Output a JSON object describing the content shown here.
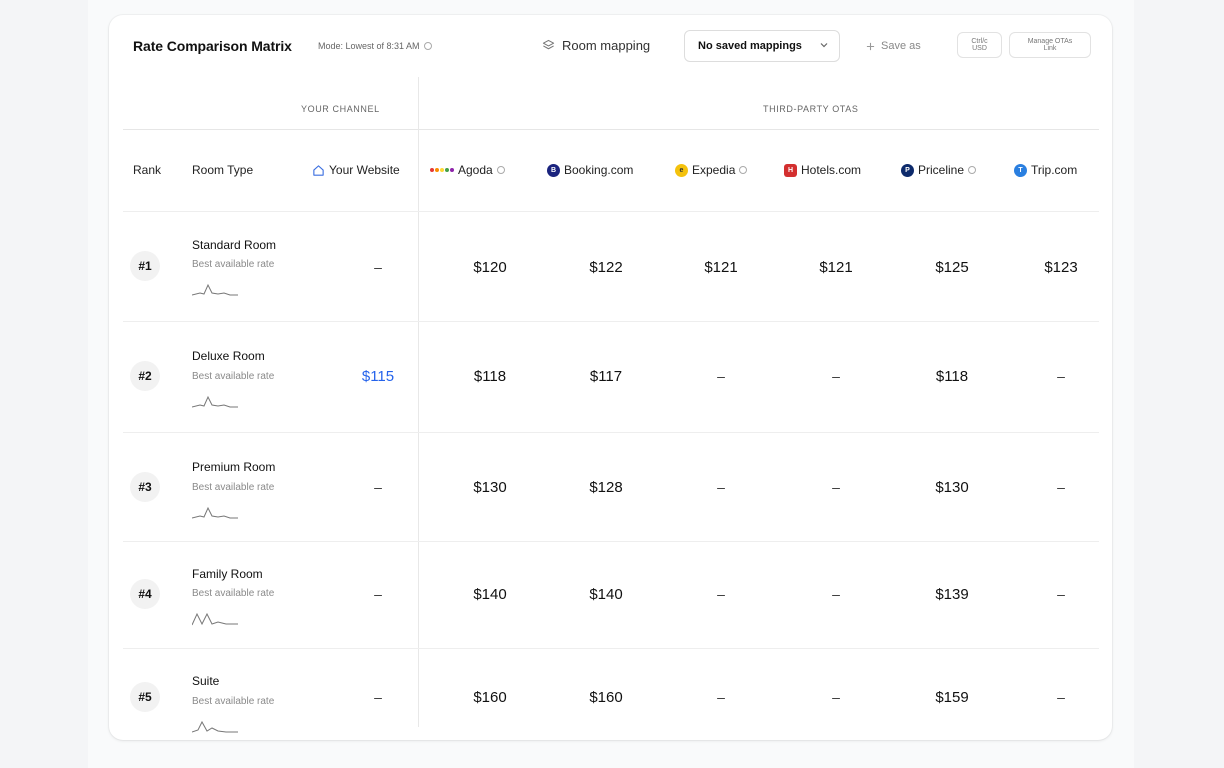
{
  "toolbar": {
    "title": "Rate Comparison Matrix",
    "mode": "Mode: Lowest of 8:31 AM",
    "room_mapping_label": "Room mapping",
    "mapping_select_value": "No saved mappings",
    "save_as_label": "Save as",
    "btn_a_label": "Ctrl/c\nUSD",
    "btn_b_label": "Manage OTAs\nLink"
  },
  "groups": {
    "your_channel": "YOUR CHANNEL",
    "third_party": "THIRD-PARTY OTAS"
  },
  "columns": {
    "rank": "Rank",
    "room_type": "Room Type",
    "your_website": "Your Website",
    "otas": [
      "Agoda",
      "Booking.com",
      "Expedia",
      "Hotels.com",
      "Priceline",
      "Trip.com"
    ]
  },
  "colors": {
    "accent": "#2563eb",
    "booking": "#1a237e",
    "expedia": "#f4c20d",
    "hotels": "#d32f2f",
    "priceline": "#0d2a6b",
    "trip": "#2a7fe0"
  },
  "rows": [
    {
      "rank": "#1",
      "room": "Standard Room",
      "sub": "Best available rate",
      "website": "–",
      "prices": [
        "$120",
        "$122",
        "$121",
        "$121",
        "$125",
        "$123"
      ]
    },
    {
      "rank": "#2",
      "room": "Deluxe Room",
      "sub": "Best available rate",
      "website": "$115",
      "prices": [
        "$118",
        "$117",
        "–",
        "–",
        "$118",
        "–"
      ]
    },
    {
      "rank": "#3",
      "room": "Premium Room",
      "sub": "Best available rate",
      "website": "–",
      "prices": [
        "$130",
        "$128",
        "–",
        "–",
        "$130",
        "–"
      ]
    },
    {
      "rank": "#4",
      "room": "Family Room",
      "sub": "Best available rate",
      "website": "–",
      "prices": [
        "$140",
        "$140",
        "–",
        "–",
        "$139",
        "–"
      ]
    },
    {
      "rank": "#5",
      "room": "Suite",
      "sub": "Best available rate",
      "website": "–",
      "prices": [
        "$160",
        "$160",
        "–",
        "–",
        "$159",
        "–"
      ]
    }
  ]
}
